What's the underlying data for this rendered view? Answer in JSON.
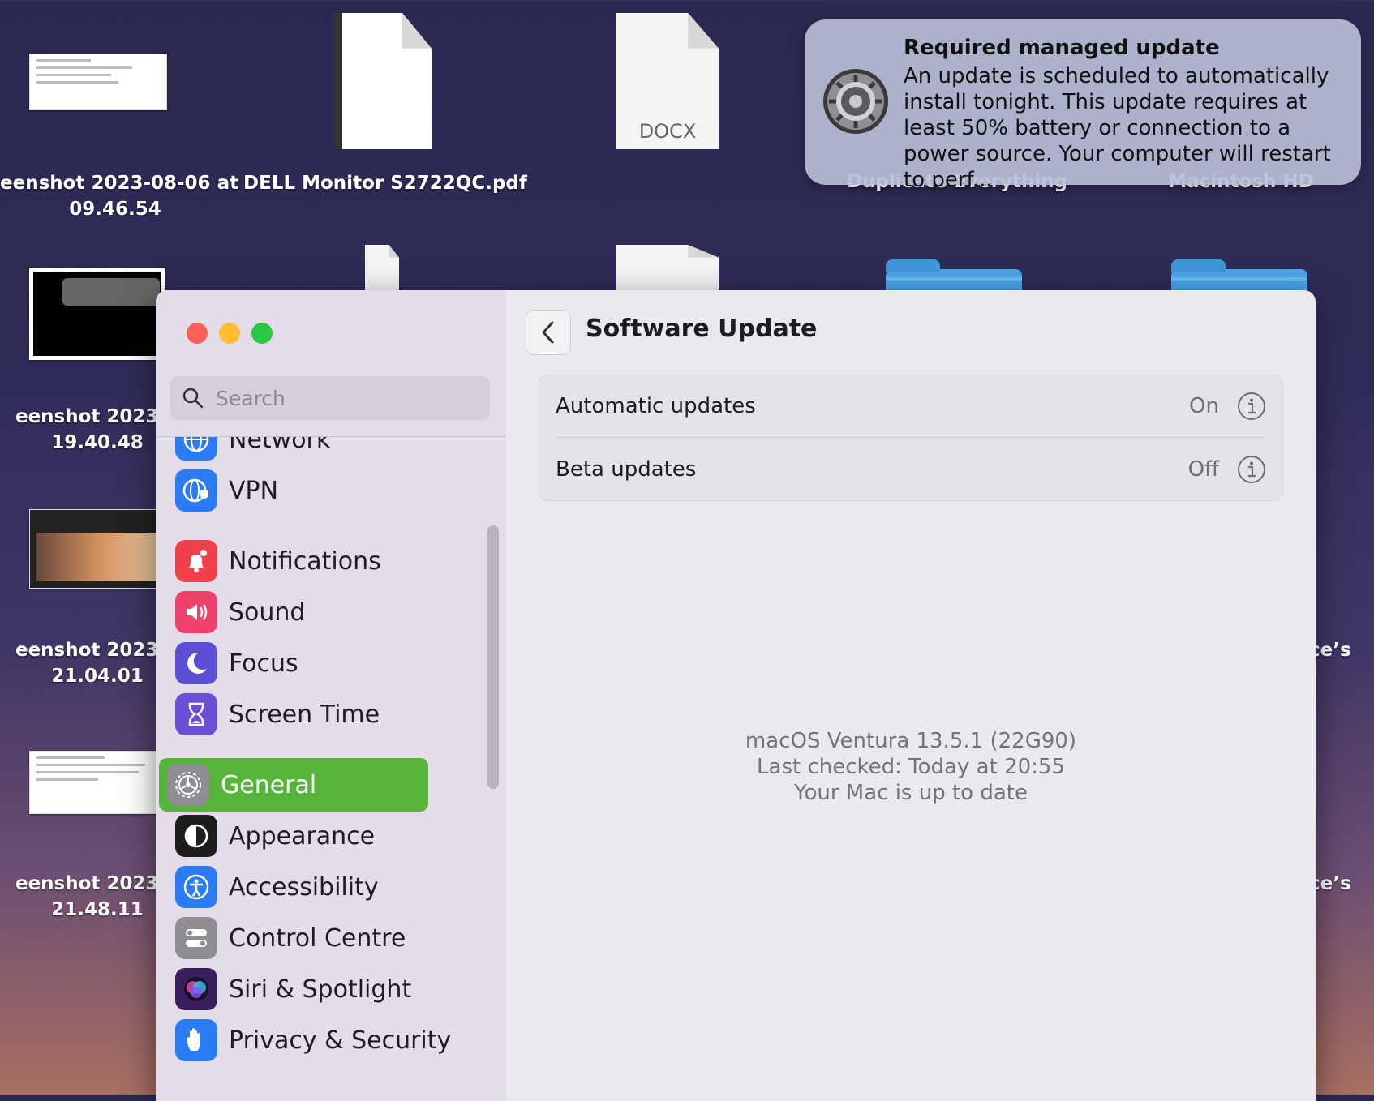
{
  "desktop": {
    "items": [
      {
        "label": "eenshot 2023-08-06 at\n09.46.54"
      },
      {
        "label": "DELL Monitor S2722QC.pdf"
      },
      {
        "label": "DOCX"
      },
      {
        "label": "Duplicate Everything"
      },
      {
        "label": "Macintosh HD"
      },
      {
        "label": "eenshot 2023-0\n19.40.48"
      },
      {
        "label": "eenshot 2023-0\n21.04.01"
      },
      {
        "label": "eenshot 2023-0\n21.48.11"
      },
      {
        "label": "ce’s"
      },
      {
        "label": "ce’s"
      }
    ]
  },
  "notification": {
    "title": "Required managed update",
    "body": "An update is scheduled to automatically install tonight. This update requires at least 50% battery or connection to a power source. Your computer will restart to perf...",
    "icon": "settings-gear-icon"
  },
  "window": {
    "controls": {
      "close": "#ff5f57",
      "minimize": "#febc2e",
      "zoom": "#28c840"
    },
    "search": {
      "placeholder": "Search"
    },
    "sidebar": {
      "items": [
        {
          "label": "Network",
          "icon": "globe-icon",
          "color": "#2a7cf6"
        },
        {
          "label": "VPN",
          "icon": "vpn-globe-icon",
          "color": "#2a7cf6"
        },
        {
          "label": "Notifications",
          "icon": "bell-icon",
          "color": "#f0404a"
        },
        {
          "label": "Sound",
          "icon": "speaker-icon",
          "color": "#f0406c"
        },
        {
          "label": "Focus",
          "icon": "moon-icon",
          "color": "#5b4fd6"
        },
        {
          "label": "Screen Time",
          "icon": "hourglass-icon",
          "color": "#6a4fd6"
        },
        {
          "label": "General",
          "icon": "gear-icon",
          "color": "#8d8d92",
          "selected": true
        },
        {
          "label": "Appearance",
          "icon": "appearance-icon",
          "color": "#1d1d1f"
        },
        {
          "label": "Accessibility",
          "icon": "accessibility-icon",
          "color": "#2a7cf6"
        },
        {
          "label": "Control Centre",
          "icon": "toggles-icon",
          "color": "#8d8d92"
        },
        {
          "label": "Siri & Spotlight",
          "icon": "siri-icon",
          "color": "#3a1f5c"
        },
        {
          "label": "Privacy & Security",
          "icon": "hand-icon",
          "color": "#2a7cf6"
        }
      ]
    },
    "main": {
      "title": "Software Update",
      "rows": [
        {
          "label": "Automatic updates",
          "value": "On"
        },
        {
          "label": "Beta updates",
          "value": "Off"
        }
      ],
      "status": {
        "version": "macOS Ventura 13.5.1 (22G90)",
        "last_checked": "Last checked: Today at 20:55",
        "message": "Your Mac is up to date"
      }
    }
  }
}
